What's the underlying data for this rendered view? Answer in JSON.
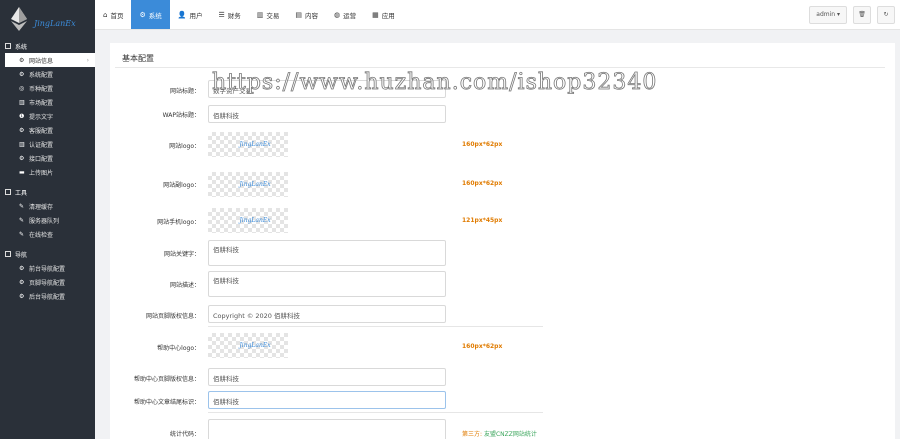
{
  "brand": {
    "logo_text": "JingLanEx"
  },
  "topbar": {
    "tabs": [
      {
        "icon": "home-icon",
        "glyph": "⌂",
        "label": "首页",
        "active": false
      },
      {
        "icon": "gear-icon",
        "glyph": "⚙",
        "label": "系统",
        "active": true
      },
      {
        "icon": "user-icon",
        "glyph": "👤",
        "label": "用户",
        "active": false
      },
      {
        "icon": "list-icon",
        "glyph": "☰",
        "label": "财务",
        "active": false
      },
      {
        "icon": "bar-chart-icon",
        "glyph": "▥",
        "label": "交易",
        "active": false
      },
      {
        "icon": "document-icon",
        "glyph": "▤",
        "label": "内容",
        "active": false
      },
      {
        "icon": "globe-icon",
        "glyph": "◍",
        "label": "运营",
        "active": false
      },
      {
        "icon": "grid-icon",
        "glyph": "▦",
        "label": "应用",
        "active": false
      }
    ],
    "admin_label": "admin ▾",
    "trash_glyph": "🗑",
    "refresh_glyph": "↻"
  },
  "sidebar": {
    "groups": [
      {
        "title": "系统",
        "items": [
          {
            "label": "网站信息",
            "glyph": "⚙",
            "active": true
          },
          {
            "label": "系统配置",
            "glyph": "⚙"
          },
          {
            "label": "币种配置",
            "glyph": "◎"
          },
          {
            "label": "市场配置",
            "glyph": "▥"
          },
          {
            "label": "提示文字",
            "glyph": "❶"
          },
          {
            "label": "客服配置",
            "glyph": "⚙"
          },
          {
            "label": "认证配置",
            "glyph": "▥"
          },
          {
            "label": "接口配置",
            "glyph": "⚙"
          },
          {
            "label": "上传图片",
            "glyph": "▬"
          }
        ]
      },
      {
        "title": "工具",
        "items": [
          {
            "label": "清理缓存",
            "glyph": "✎"
          },
          {
            "label": "服务器队列",
            "glyph": "✎"
          },
          {
            "label": "在线检查",
            "glyph": "✎"
          }
        ]
      },
      {
        "title": "导航",
        "items": [
          {
            "label": "前台导航配置",
            "glyph": "⚙"
          },
          {
            "label": "页脚导航配置",
            "glyph": "⚙"
          },
          {
            "label": "后台导航配置",
            "glyph": "⚙"
          }
        ]
      }
    ]
  },
  "panel": {
    "title": "基本配置",
    "site_title_label": "网站标题：",
    "site_title_value": "数字资产交易",
    "wap_title_label": "WAP站标题：",
    "wap_title_value": "佰耕科技",
    "logo_label": "网站logo：",
    "logo_hint": "160px*62px",
    "sublogo_label": "网站副logo：",
    "sublogo_hint": "160px*62px",
    "mobile_logo_label": "网站手机logo：",
    "mobile_logo_hint": "121px*45px",
    "keywords_label": "网站关键字：",
    "keywords_value": "佰耕科技",
    "description_label": "网站描述：",
    "description_value": "佰耕科技",
    "copyright_label": "网站页脚版权信息：",
    "copyright_value": "Copyright © 2020 佰耕科技",
    "help_logo_label": "帮助中心logo：",
    "help_logo_hint": "160px*62px",
    "help_copyright_label": "帮助中心页脚版权信息：",
    "help_copyright_value": "佰耕科技",
    "help_article_label": "帮助中心文章结尾标识：",
    "help_article_value": "佰耕科技",
    "stats_label": "统计代码：",
    "stats_hint_prefix": "第三方:",
    "stats_hint_link": "友盟CNZZ网站统计"
  },
  "watermark": "https://www.huzhan.com/ishop32340"
}
